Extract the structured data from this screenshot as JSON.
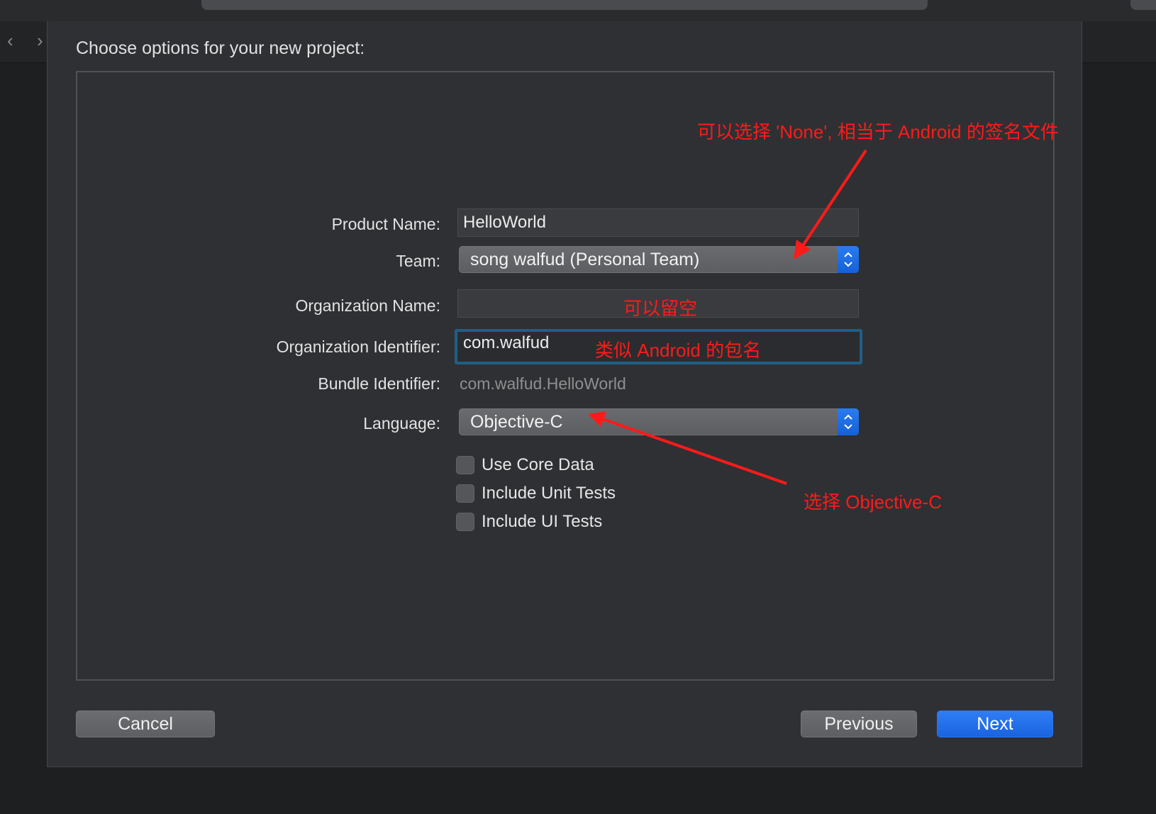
{
  "window": {
    "sheet_title": "Choose options for your new project:",
    "nav_back_glyph": "‹",
    "nav_forward_glyph": "›"
  },
  "form": {
    "product_name_label": "Product Name:",
    "product_name_value": "HelloWorld",
    "team_label": "Team:",
    "team_value": "song walfud (Personal Team)",
    "org_name_label": "Organization Name:",
    "org_name_value": "",
    "org_id_label": "Organization Identifier:",
    "org_id_value": "com.walfud",
    "bundle_id_label": "Bundle Identifier:",
    "bundle_id_value": "com.walfud.HelloWorld",
    "language_label": "Language:",
    "language_value": "Objective-C",
    "checkboxes": [
      {
        "label": "Use Core Data",
        "checked": false
      },
      {
        "label": "Include Unit Tests",
        "checked": false
      },
      {
        "label": "Include UI Tests",
        "checked": false
      }
    ]
  },
  "annotations": {
    "team_note": "可以选择 'None', 相当于 Android 的签名文件",
    "org_name_note": "可以留空",
    "org_id_note": "类似 Android 的包名",
    "language_note": "选择 Objective-C",
    "color": "#ff1a1a"
  },
  "buttons": {
    "cancel": "Cancel",
    "previous": "Previous",
    "next": "Next"
  },
  "colors": {
    "accent_blue": "#1a63e0",
    "sheet_bg": "#2f3033",
    "focus_ring": "#1f5f86"
  }
}
